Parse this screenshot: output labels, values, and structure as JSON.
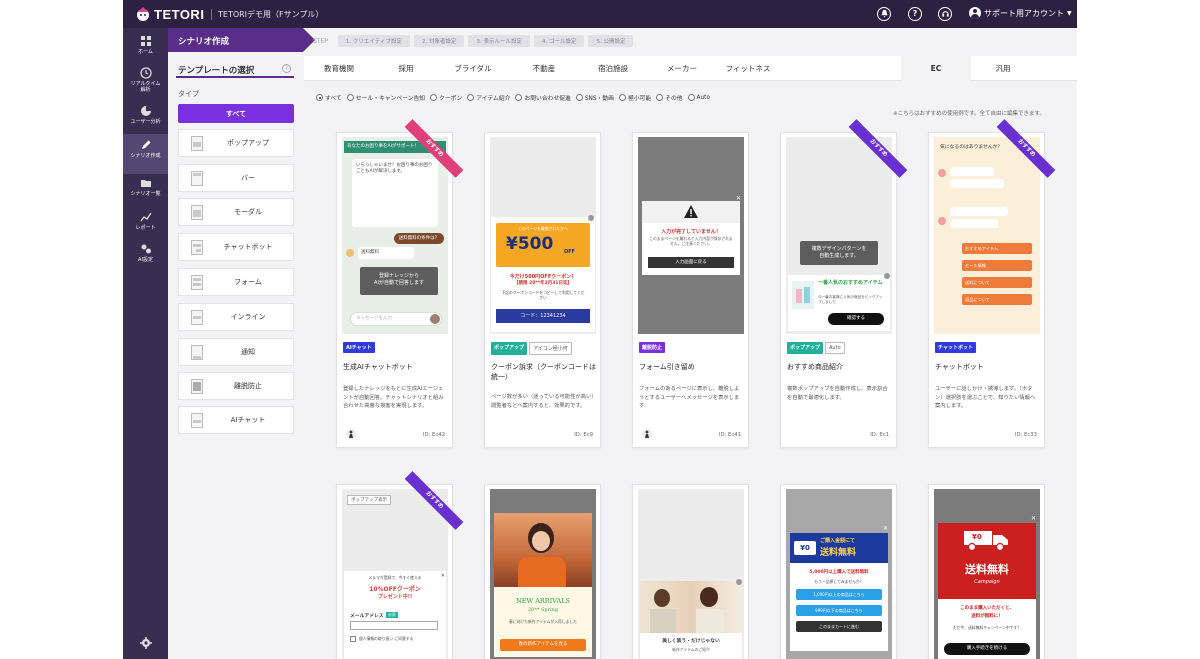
{
  "header": {
    "logo_text": "TETORI",
    "project": "TETORIデモ用（Fサンプル）",
    "account": "サポート用アカウント",
    "help_glyph": "?",
    "colors": {
      "topbar": "#2d2142",
      "accent": "#7a2fe0",
      "scenario": "#5a2d8a"
    }
  },
  "nav": [
    {
      "label": "ホーム",
      "icon": "grid-icon"
    },
    {
      "label": "リアルタイム\n解析",
      "icon": "clock-icon"
    },
    {
      "label": "ユーザー分析",
      "icon": "pie-chart-icon"
    },
    {
      "label": "シナリオ作成",
      "icon": "pencil-icon"
    },
    {
      "label": "シナリオ一覧",
      "icon": "folder-icon"
    },
    {
      "label": "レポート",
      "icon": "line-chart-icon"
    },
    {
      "label": "AI設定",
      "icon": "ai-icon"
    }
  ],
  "scenario": {
    "title": "シナリオ作成",
    "step_label": "STEP",
    "steps": [
      "1. クリエイティブ設定",
      "2. 対象者設定",
      "3. 表示ルール設定",
      "4. ゴール設定",
      "5. 公開設定"
    ]
  },
  "template_panel": {
    "title": "テンプレートの選択",
    "type_label": "タイプ",
    "types": [
      "すべて",
      "ポップアップ",
      "バー",
      "モーダル",
      "チャットボット",
      "フォーム",
      "インライン",
      "通知",
      "離脱防止",
      "AIチャット"
    ]
  },
  "categories": [
    "教育機関",
    "採用",
    "ブライダル",
    "不動産",
    "宿泊施設",
    "メーカー",
    "フィットネス",
    "EC",
    "汎用"
  ],
  "active_category": "EC",
  "filters": [
    "すべて",
    "セール・キャンペーン告知",
    "クーポン",
    "アイテム紹介",
    "お問い合わせ促進",
    "SNS・動画",
    "極小可能",
    "その他",
    "Auto"
  ],
  "note": "※こちらはおすすめの使用例です。全て自由に編集できます。",
  "cards": [
    {
      "ribbon": "おすすめ",
      "tags": [
        {
          "label": "AIチャット",
          "color": "#2f3ae0"
        }
      ],
      "title": "生成AIチャットボット",
      "desc": "登録したナレッジをもとに生成AIエージェントが自動回答。チャットシナリオと組み合わせた高度な接客を実現します。",
      "id": "ID: Ec42",
      "preview": {
        "header": "あなたのお困り事をAIがサポート！",
        "greeting": "いらっしゃいませ！お困り事のお困りごともAIが解決します。",
        "bubble": "送料無料の条件は？",
        "bubble_sub": "送料無料",
        "overlay_line1": "登録ナレッジから",
        "overlay_line2": "AIが自動で回答します",
        "input": "メッセージを入力"
      }
    },
    {
      "ribbon": "",
      "tags": [
        {
          "label": "ポップアップ",
          "color": "#22b09a"
        },
        {
          "label": "アイコン極小可",
          "color": ""
        }
      ],
      "title": "クーポン訴求（クーポンコードは統一）",
      "desc": "ページ数が多い（迷っている可能性が高い）閲覧者などへ案内すると、効果的です。",
      "id": "ID: Ec9",
      "preview": {
        "top": "このページを離脱された方へ",
        "amount": "¥500",
        "off": "OFF",
        "line1": "今だけ500円OFFクーポン！",
        "line2": "【期限 20**年3月31日迄】",
        "line3": "下記のクーポンコードをコピーして利用してください",
        "code": "コード：12341234"
      }
    },
    {
      "ribbon": "",
      "tags": [
        {
          "label": "離脱防止",
          "color": "#7a2fe0"
        }
      ],
      "title": "フォーム引き留め",
      "desc": "フォームのあるページに表示し、離脱しようとするユーザーへメッセージを表示します",
      "id": "ID: Ec41",
      "preview": {
        "warn": "入力が完了していません！",
        "sub": "このままページを離れると入力内容が保存されません。ご注意ください。",
        "button": "入力画面に戻る"
      }
    },
    {
      "ribbon": "おすすめ",
      "tags": [
        {
          "label": "ポップアップ",
          "color": "#22b09a"
        },
        {
          "label": "Auto",
          "color": ""
        }
      ],
      "title": "おすすめ商品紹介",
      "desc": "複数ポップアップを自動作成し、表示割合を自動で最適化します。",
      "id": "ID: Ec1",
      "preview": {
        "bubble_line1": "複数デザインパターンを",
        "bubble_line2": "自動生成します。",
        "product_title": "一番人気のおすすめアイテム",
        "product_desc": "今一番お客様に人気の商品をピックアップしました",
        "button": "確認する"
      }
    },
    {
      "ribbon": "おすすめ",
      "tags": [
        {
          "label": "チャットボット",
          "color": "#2f3ae0"
        }
      ],
      "title": "チャットボット",
      "desc": "ユーザーに話しかけ・誘導します。（ボタン）選択肢を選ぶことで、知りたい情報へ案内します。",
      "id": "ID: Ec33",
      "preview": {
        "header": "気になるのはありませんか？",
        "options": [
          "おすすめアイテム",
          "セール情報",
          "送料について",
          "返品について"
        ]
      }
    }
  ],
  "cards_row2": [
    {
      "ribbon": "おすすめ",
      "top": "ポップアップ表示",
      "line1": "メルマガ登録で、今すぐ使える",
      "line2": "10%OFFクーポン",
      "line3": "プレゼント中!!",
      "field": "メールアドレス",
      "req": "必須",
      "check": "個人情報の取り扱い に同意する"
    },
    {
      "top": "NEW ARRIVALS",
      "sub": "20** Spring",
      "desc": "春に向けた新作アイテムが入荷しました",
      "button": "春の新作アイテムを見る"
    },
    {
      "line": "美しく装う・だけじゃない",
      "desc": "新作アイテムのご紹介"
    },
    {
      "amount": "¥0",
      "line1": "ご購入金額にて",
      "line2": "送料無料",
      "line3": "5,000円以上購入で送料無料",
      "line4": "もう一品探してみませんか？",
      "b1": "1,000円以上の商品はこちら",
      "b2": "999円以下の商品はこちら",
      "b3": "このままカートに進む"
    },
    {
      "amount": "¥0",
      "line1": "送料無料",
      "line2": "Campaign",
      "line3": "このまま購入いただくと、",
      "line4": "送料が無料に！",
      "desc": "ただ今、送料無料キャンペーン中です！",
      "button": "購入手続きを続ける"
    }
  ]
}
